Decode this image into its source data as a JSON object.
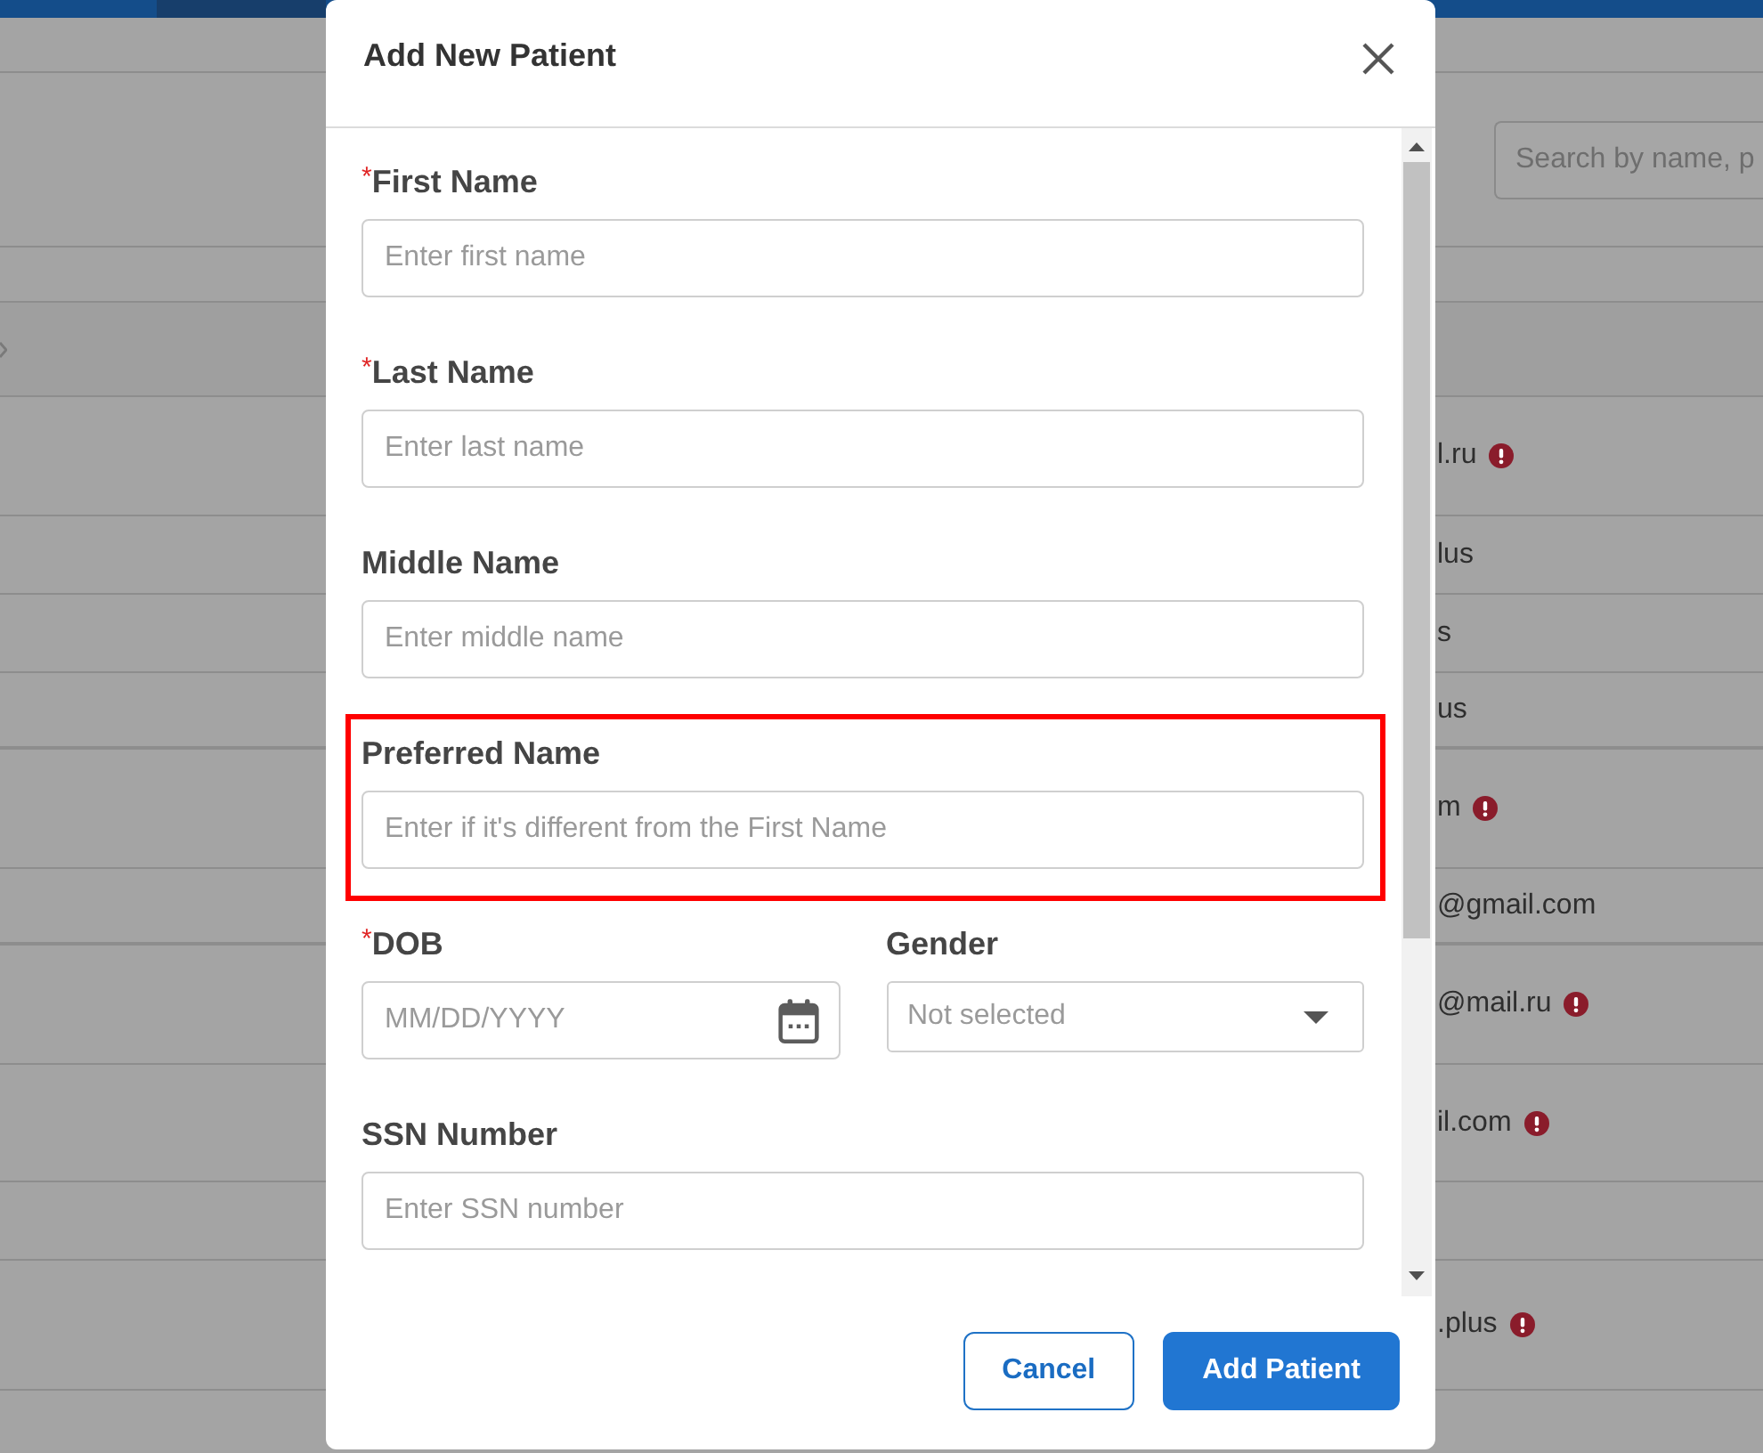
{
  "background": {
    "search": {
      "placeholder": "Search by name, p"
    },
    "table": {
      "rows": [
        {
          "column_1": "l.ru",
          "alert": true
        },
        {
          "column_1": "lus",
          "alert": false
        },
        {
          "column_1": "s",
          "alert": false
        },
        {
          "column_1": "us",
          "alert": false
        },
        {
          "column_1": "m",
          "alert": true
        },
        {
          "column_1": "@gmail.com",
          "alert": false
        },
        {
          "column_1": "@mail.ru",
          "alert": true
        },
        {
          "column_1": "il.com",
          "alert": true
        },
        {
          "column_1": ".plus",
          "alert": true
        }
      ]
    }
  },
  "dialog": {
    "title": "Add New Patient",
    "form": {
      "rows": [
        [
          {
            "kind": "text",
            "label": "First Name",
            "required_mark": "*",
            "placeholder": "Enter first name",
            "highlighted": false
          }
        ],
        [
          {
            "kind": "text",
            "label": "Last Name",
            "required_mark": "*",
            "placeholder": "Enter last name",
            "highlighted": false
          }
        ],
        [
          {
            "kind": "text",
            "label": "Middle Name",
            "placeholder": "Enter middle name",
            "highlighted": false
          }
        ],
        [
          {
            "kind": "text",
            "label": "Preferred Name",
            "placeholder": "Enter if it's different from the First Name",
            "highlighted": true
          }
        ],
        [
          {
            "kind": "date",
            "label": "DOB",
            "required_mark": "*",
            "placeholder": "MM/DD/YYYY",
            "highlighted": false
          },
          {
            "kind": "select",
            "label": "Gender",
            "placeholder": "Not selected",
            "highlighted": false
          }
        ],
        [
          {
            "kind": "text",
            "label": "SSN Number",
            "placeholder": "Enter SSN number",
            "highlighted": false
          }
        ]
      ]
    },
    "buttons": [
      {
        "label": "Cancel",
        "kind": "secondary"
      },
      {
        "label": "Add Patient",
        "kind": "primary"
      }
    ]
  }
}
